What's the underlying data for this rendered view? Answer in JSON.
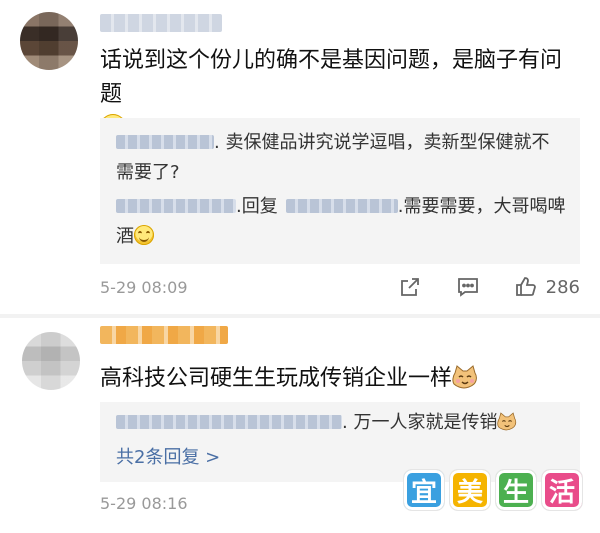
{
  "comments": [
    {
      "text": "话说到这个份儿的确不是基因问题，是脑子有问题",
      "replies": [
        {
          "text": ". 卖保健品讲究说学逗唱，卖新型保健就不需要了?"
        },
        {
          "reply_word": ".回复",
          "text": ".需要需要，大哥喝啤酒"
        }
      ],
      "time": "5-29 08:09",
      "like_count": "286",
      "icons": [
        "share-icon",
        "comment-icon",
        "like-icon"
      ]
    },
    {
      "text": "高科技公司硬生生玩成传销企业一样",
      "replies": [
        {
          "text": ". 万一人家就是传销"
        }
      ],
      "more_replies": "共2条回复 >",
      "time": "5-29 08:16"
    }
  ],
  "watermark": {
    "chars": [
      "宜",
      "美",
      "生",
      "活"
    ],
    "colors": [
      "#3aa0e0",
      "#f5b400",
      "#4cb050",
      "#e94c8a"
    ]
  }
}
